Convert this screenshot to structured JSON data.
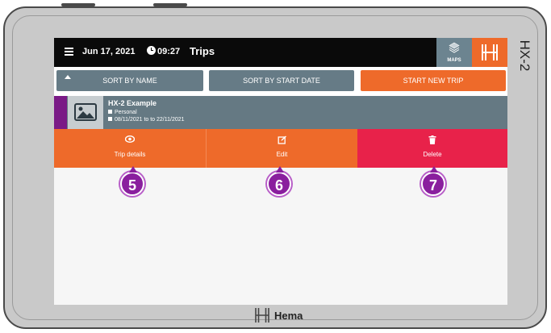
{
  "device": {
    "side_label": "HX-2",
    "brand": "Hema"
  },
  "topbar": {
    "date": "Jun 17, 2021",
    "time": "09:27",
    "title": "Trips",
    "maps_label": "MAPS"
  },
  "sort": {
    "by_name": "SORT BY NAME",
    "by_start_date": "SORT BY START DATE",
    "start_new_trip": "START NEW TRIP"
  },
  "trip": {
    "name": "HX-2 Example",
    "type": "Personal",
    "dates": "08/11/2021 to to 22/11/2021"
  },
  "actions": {
    "details": "Trip details",
    "edit": "Edit",
    "delete": "Delete"
  },
  "badges": [
    "5",
    "6",
    "7"
  ],
  "colors": {
    "orange": "#ee6a2a",
    "slate": "#657983",
    "delete": "#e8224a",
    "purple": "#8a1f9e",
    "accent": "#7a1a86"
  }
}
